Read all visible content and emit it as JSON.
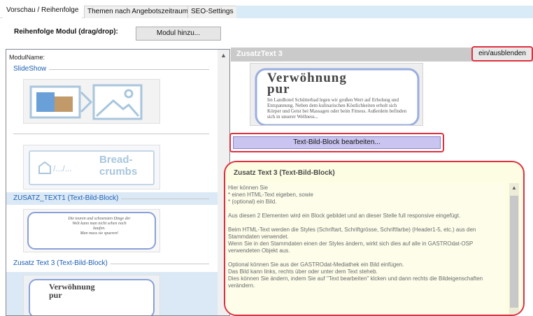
{
  "tabs": [
    {
      "label": "Vorschau / Reihenfolge"
    },
    {
      "label": "Themen nach Angebotszeitraum"
    },
    {
      "label": "SEO-Settings"
    }
  ],
  "header": {
    "order_label": "Reihenfolge Modul (drag/drop):",
    "add_button": "Modul hinzu..."
  },
  "list": {
    "column_header": "ModulName:",
    "groups": [
      {
        "title": "SlideShow"
      },
      {
        "title": ""
      },
      {
        "title": "ZUSATZ_TEXT1 (Text-Bild-Block)",
        "thumb_lines": [
          "Die teuren und schoensten Dinge der",
          "Welt kann man nicht sehen noch",
          "kaufen.",
          "Man muss sie spueren!"
        ]
      },
      {
        "title": "Zusatz Text 3 (Text-Bild-Block)",
        "thumb_title_1": "Verwöhnung",
        "thumb_title_2": "pur"
      }
    ],
    "breadcrumbs_thumb": {
      "line1": "Bread-",
      "line2": "crumbs",
      "path": "/.../..."
    }
  },
  "detail": {
    "title": "ZusatzText 3",
    "toggle_button": "ein/ausblenden",
    "preview": {
      "heading_1": "Verwöhnung",
      "heading_2": "pur",
      "body": "Im Landhotel Schütterbad legen wir großen Wert auf Erholung und Entspannung. Neben dem kulinarischen Köstlichkeiten erholt sich Körper und Geist bei Massagen oder beim Fitness. Außerdem befinden sich in unserer Wellness..."
    },
    "edit_button": "Text-Bild-Block  bearbeiten..."
  },
  "info": {
    "title": "Zusatz Text 3 (Text-Bild-Block)",
    "paragraphs": [
      "Hier können Sie\n* einen HTML-Text eigeben, sowie\n* (optional) ein Bild.",
      "Aus diesen 2 Elementen wird ein Block gebildet und an dieser Stelle full responsive eingefügt.",
      "Beim HTML-Text werden die Styles (Schriftart, Schriftgrösse, Schriftfarbe) (Header1-5, etc.) aus den Stammdaten verwendet.\nWenn Sie in den Stammdaten einen der Styles ändern, wirkt sich dies auf alle in GASTROdat-OSP verwendeten Objekt aus.",
      "Optional können Sie aus der GASTROdat-Mediathek ein Bild einfügen.\nDas Bild kann links, rechts über oder unter dem Text steheb.\nDies können Sie ändern, indem Sie auf \"Text bearbeiten\" klcken und dann rechts die Bildeigenschaften verändern."
    ]
  },
  "colors": {
    "highlight_border": "#e03040",
    "link_blue": "#1c5fb2",
    "info_background": "#fdfde3",
    "edit_button": "#c9c4f0"
  }
}
